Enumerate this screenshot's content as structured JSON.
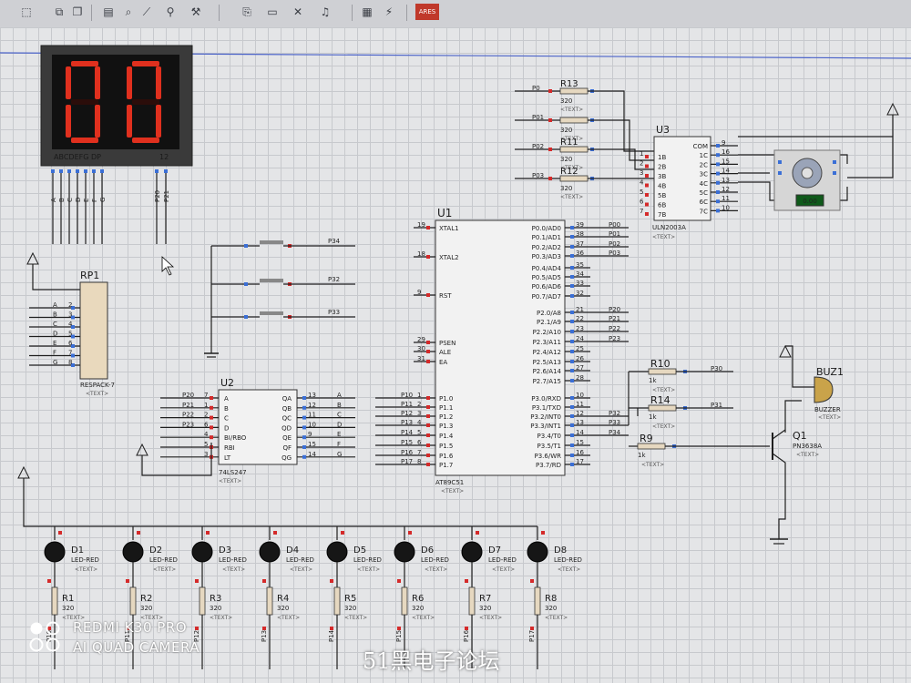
{
  "toolbar": {
    "icons": [
      "select-icon",
      "copy-icon",
      "paste-icon",
      "block-icon",
      "zoom-icon",
      "wire-icon",
      "search-icon",
      "tools-icon",
      "netlist-icon",
      "page-icon",
      "delete-icon",
      "sound-icon",
      "report-icon",
      "flash-icon",
      "ares-icon"
    ],
    "ares_label": "ARES"
  },
  "display": {
    "digits": "00",
    "pins_label": "ABCDEFG DP",
    "com_label": "12",
    "seg_labels": [
      "A",
      "B",
      "C",
      "D",
      "E",
      "F",
      "G"
    ],
    "dig_labels": [
      "P20",
      "P21"
    ]
  },
  "rp1": {
    "ref": "RP1",
    "type": "RESPACK-7",
    "text": "<TEXT>",
    "pins": [
      "A",
      "B",
      "C",
      "D",
      "E",
      "F",
      "G"
    ],
    "nums": [
      "2",
      "3",
      "4",
      "5",
      "6",
      "7",
      "8"
    ]
  },
  "buttons": {
    "nets": [
      "P34",
      "P32",
      "P33"
    ]
  },
  "u2": {
    "ref": "U2",
    "type": "74LS247",
    "text": "<TEXT>",
    "left_pins": [
      "A",
      "B",
      "C",
      "D",
      "BI/RBO",
      "RBI",
      "LT"
    ],
    "left_nums": [
      "7",
      "1",
      "2",
      "6",
      "4",
      "5",
      "3"
    ],
    "left_nets": [
      "P20",
      "P21",
      "P22",
      "P23",
      "",
      "",
      ""
    ],
    "right_pins": [
      "QA",
      "QB",
      "QC",
      "QD",
      "QE",
      "QF",
      "QG"
    ],
    "right_nums": [
      "13",
      "12",
      "11",
      "10",
      "9",
      "15",
      "14"
    ],
    "right_nets": [
      "A",
      "B",
      "C",
      "D",
      "E",
      "F",
      "G"
    ]
  },
  "u1": {
    "ref": "U1",
    "type": "AT89C51",
    "text": "<TEXT>",
    "left_pins": [
      "XTAL1",
      "XTAL2",
      "RST",
      "PSEN",
      "ALE",
      "EA",
      "P1.0",
      "P1.1",
      "P1.2",
      "P1.3",
      "P1.4",
      "P1.5",
      "P1.6",
      "P1.7"
    ],
    "left_nums": [
      "19",
      "18",
      "9",
      "29",
      "30",
      "31",
      "1",
      "2",
      "3",
      "4",
      "5",
      "6",
      "7",
      "8"
    ],
    "left_nets": [
      "",
      "",
      "",
      "",
      "",
      "",
      "P10",
      "P11",
      "P12",
      "P13",
      "P14",
      "P15",
      "P16",
      "P17"
    ],
    "right_pins": [
      "P0.0/AD0",
      "P0.1/AD1",
      "P0.2/AD2",
      "P0.3/AD3",
      "P0.4/AD4",
      "P0.5/AD5",
      "P0.6/AD6",
      "P0.7/AD7",
      "P2.0/A8",
      "P2.1/A9",
      "P2.2/A10",
      "P2.3/A11",
      "P2.4/A12",
      "P2.5/A13",
      "P2.6/A14",
      "P2.7/A15",
      "P3.0/RXD",
      "P3.1/TXD",
      "P3.2/INT0",
      "P3.3/INT1",
      "P3.4/T0",
      "P3.5/T1",
      "P3.6/WR",
      "P3.7/RD"
    ],
    "right_nums": [
      "39",
      "38",
      "37",
      "36",
      "35",
      "34",
      "33",
      "32",
      "21",
      "22",
      "23",
      "24",
      "25",
      "26",
      "27",
      "28",
      "10",
      "11",
      "12",
      "13",
      "14",
      "15",
      "16",
      "17"
    ],
    "right_nets": [
      "P00",
      "P01",
      "P02",
      "P03",
      "",
      "",
      "",
      "",
      "P20",
      "P21",
      "P22",
      "P23",
      "",
      "",
      "",
      "",
      "",
      "",
      "P32",
      "P33",
      "P34",
      "",
      "",
      ""
    ]
  },
  "u3": {
    "ref": "U3",
    "type": "ULN2003A",
    "text": "<TEXT>",
    "left_pins": [
      "1B",
      "2B",
      "3B",
      "4B",
      "5B",
      "6B",
      "7B"
    ],
    "left_nums": [
      "1",
      "2",
      "3",
      "4",
      "5",
      "6",
      "7"
    ],
    "right_pins": [
      "COM",
      "1C",
      "2C",
      "3C",
      "4C",
      "5C",
      "6C",
      "7C"
    ],
    "right_nums": [
      "9",
      "16",
      "15",
      "14",
      "13",
      "12",
      "11",
      "10"
    ],
    "motor_value": "0.00"
  },
  "r_top": [
    {
      "ref": "R13",
      "value": "320",
      "net": "P0",
      "text": "<TEXT>"
    },
    {
      "ref": "",
      "value": "320",
      "net": "P01",
      "text": "<TEXT>"
    },
    {
      "ref": "R11",
      "value": "320",
      "net": "P02",
      "text": "<TEXT>"
    },
    {
      "ref": "R12",
      "value": "320",
      "net": "P03",
      "text": "<TEXT>"
    }
  ],
  "r_mid": [
    {
      "ref": "R10",
      "value": "1k",
      "net": "P30",
      "text": "<TEXT>"
    },
    {
      "ref": "R14",
      "value": "1k",
      "net": "P31",
      "text": "<TEXT>"
    },
    {
      "ref": "R9",
      "value": "1k",
      "net": "",
      "text": "<TEXT>"
    }
  ],
  "buzzer": {
    "ref": "BUZ1",
    "type": "BUZZER",
    "text": "<TEXT>"
  },
  "q1": {
    "ref": "Q1",
    "type": "PN3638A",
    "text": "<TEXT>"
  },
  "leds": [
    {
      "ref": "D1",
      "type": "LED-RED",
      "text": "<TEXT>",
      "res": "R1",
      "value": "320",
      "net": "P10"
    },
    {
      "ref": "D2",
      "type": "LED-RED",
      "text": "<TEXT>",
      "res": "R2",
      "value": "320",
      "net": "P11"
    },
    {
      "ref": "D3",
      "type": "LED-RED",
      "text": "<TEXT>",
      "res": "R3",
      "value": "320",
      "net": "P12"
    },
    {
      "ref": "D4",
      "type": "LED-RED",
      "text": "<TEXT>",
      "res": "R4",
      "value": "320",
      "net": "P13"
    },
    {
      "ref": "D5",
      "type": "LED-RED",
      "text": "<TEXT>",
      "res": "R5",
      "value": "320",
      "net": "P14"
    },
    {
      "ref": "D6",
      "type": "LED-RED",
      "text": "<TEXT>",
      "res": "R6",
      "value": "320",
      "net": "P15"
    },
    {
      "ref": "D7",
      "type": "LED-RED",
      "text": "<TEXT>",
      "res": "R7",
      "value": "320",
      "net": "P16"
    },
    {
      "ref": "D8",
      "type": "LED-RED",
      "text": "<TEXT>",
      "res": "R8",
      "value": "320",
      "net": "P17"
    }
  ],
  "watermark": {
    "line1": "REDMI K30 PRO",
    "line2": "AI QUAD CAMERA",
    "site": "51黑电子论坛"
  },
  "colors": {
    "segment_on": "#e0301e",
    "display_bg": "#3a3a3a",
    "wire": "#1f1f1f",
    "pin_red": "#d42a2a",
    "pin_blue": "#3b6fd6",
    "component_fill": "#f2f2f2"
  }
}
